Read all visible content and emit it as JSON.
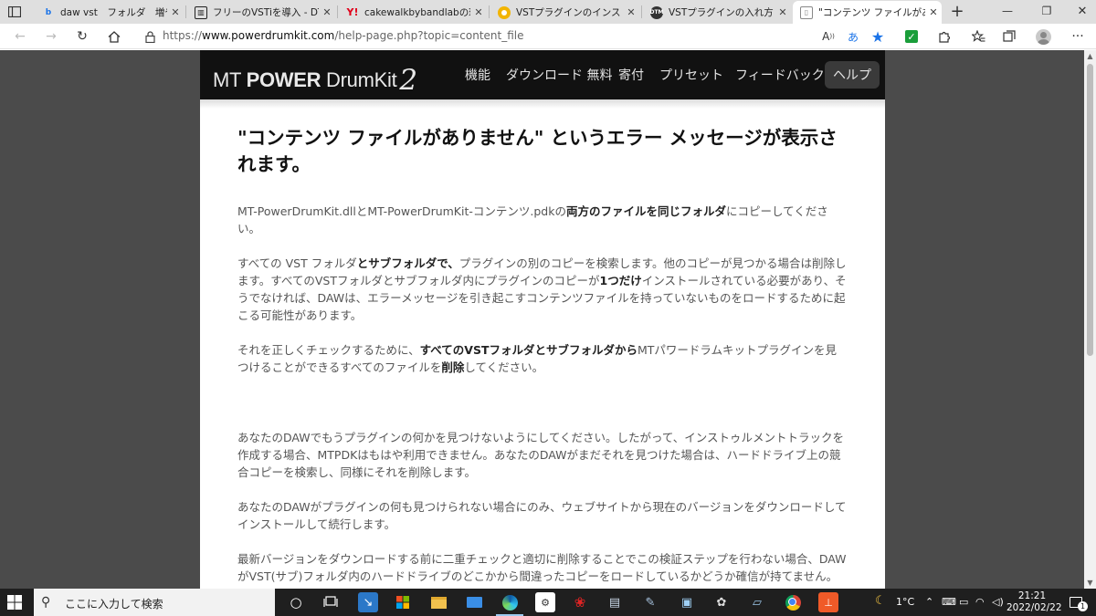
{
  "tabs": [
    {
      "title": "daw vst　フォルダ　増やし過",
      "favicon": "bing-icon",
      "color": "#1a73e8"
    },
    {
      "title": "フリーのVSTiを導入 - DTMハイ",
      "favicon": "site-icon",
      "color": "#222222"
    },
    {
      "title": "cakewalkbybandlabの環境設",
      "favicon": "yahoo-icon",
      "color": "#e0001a"
    },
    {
      "title": "VSTプラグインのインストールと",
      "favicon": "circle-icon",
      "color": "#f2b400"
    },
    {
      "title": "VSTプラグインの入れ方と使い",
      "favicon": "site-icon",
      "color": "#333333"
    },
    {
      "title": "\"コンテンツ ファイルがありませ",
      "favicon": "page-icon",
      "color": "#888888"
    }
  ],
  "address": {
    "url_prefix": "https://",
    "url_domain": "www.powerdrumkit.com",
    "url_path": "/help-page.php?topic=content_file",
    "read_aloud": "A",
    "translate": "あ"
  },
  "site": {
    "logo_mt": "MT ",
    "logo_power": "POWER",
    "logo_drumkit": " DrumKit",
    "logo_two": "2",
    "nav": [
      "機能",
      "ダウンロード 無料",
      "寄付",
      "プリセット",
      "フィードバック",
      "ヘルプ"
    ]
  },
  "article": {
    "heading": "\"コンテンツ ファイルがありません\" というエラー メッセージが表示されます。",
    "p1": {
      "a": "MT-PowerDrumKit.dllとMT-PowerDrumKit-コンテンツ.pdkの",
      "b": "両方のファイルを同じフォルダ",
      "c": "にコピーしてください。"
    },
    "p2": {
      "a": "すべての VST フォルダ",
      "b": "とサブフォルダで、",
      "c": "プラグインの別のコピーを検索します。他のコピーが見つかる場合は削除します。すべてのVSTフォルダとサブフォルダ内にプラグインのコピーが",
      "d": "1つだけ",
      "e": "インストールされている必要があり、そうでなければ、DAWは、エラーメッセージを引き起こすコンテンツファイルを持っていないものをロードするために起こる可能性があります。"
    },
    "p3": {
      "a": "それを正しくチェックするために、",
      "b": "すべてのVSTフォルダとサブフォルダから",
      "c": "MTパワードラムキットプラグインを見つけることができるすべてのファイルを",
      "d": "削除",
      "e": "してください。"
    },
    "p4": "あなたのDAWでもうプラグインの何かを見つけないようにしてください。したがって、インストゥルメントトラックを作成する場合、MTPDKはもはや利用できません。あなたのDAWがまだそれを見つけた場合は、ハードドライブ上の競合コピーを検索し、同様にそれを削除します。",
    "p5": "あなたのDAWがプラグインの何も見つけられない場合にのみ、ウェブサイトから現在のバージョンをダウンロードしてインストールして続行します。",
    "p6": "最新バージョンをダウンロードする前に二重チェックと適切に削除することでこの検証ステップを行わない場合、DAWがVST(サブ)フォルダ内のハードドライブのどこかから間違ったコピーをロードしているかどうか確信が持てません。"
  },
  "taskbar": {
    "search_placeholder": "ここに入力して検索",
    "temperature": "1°C",
    "time": "21:21",
    "date": "2022/02/22",
    "notifications": "1"
  }
}
